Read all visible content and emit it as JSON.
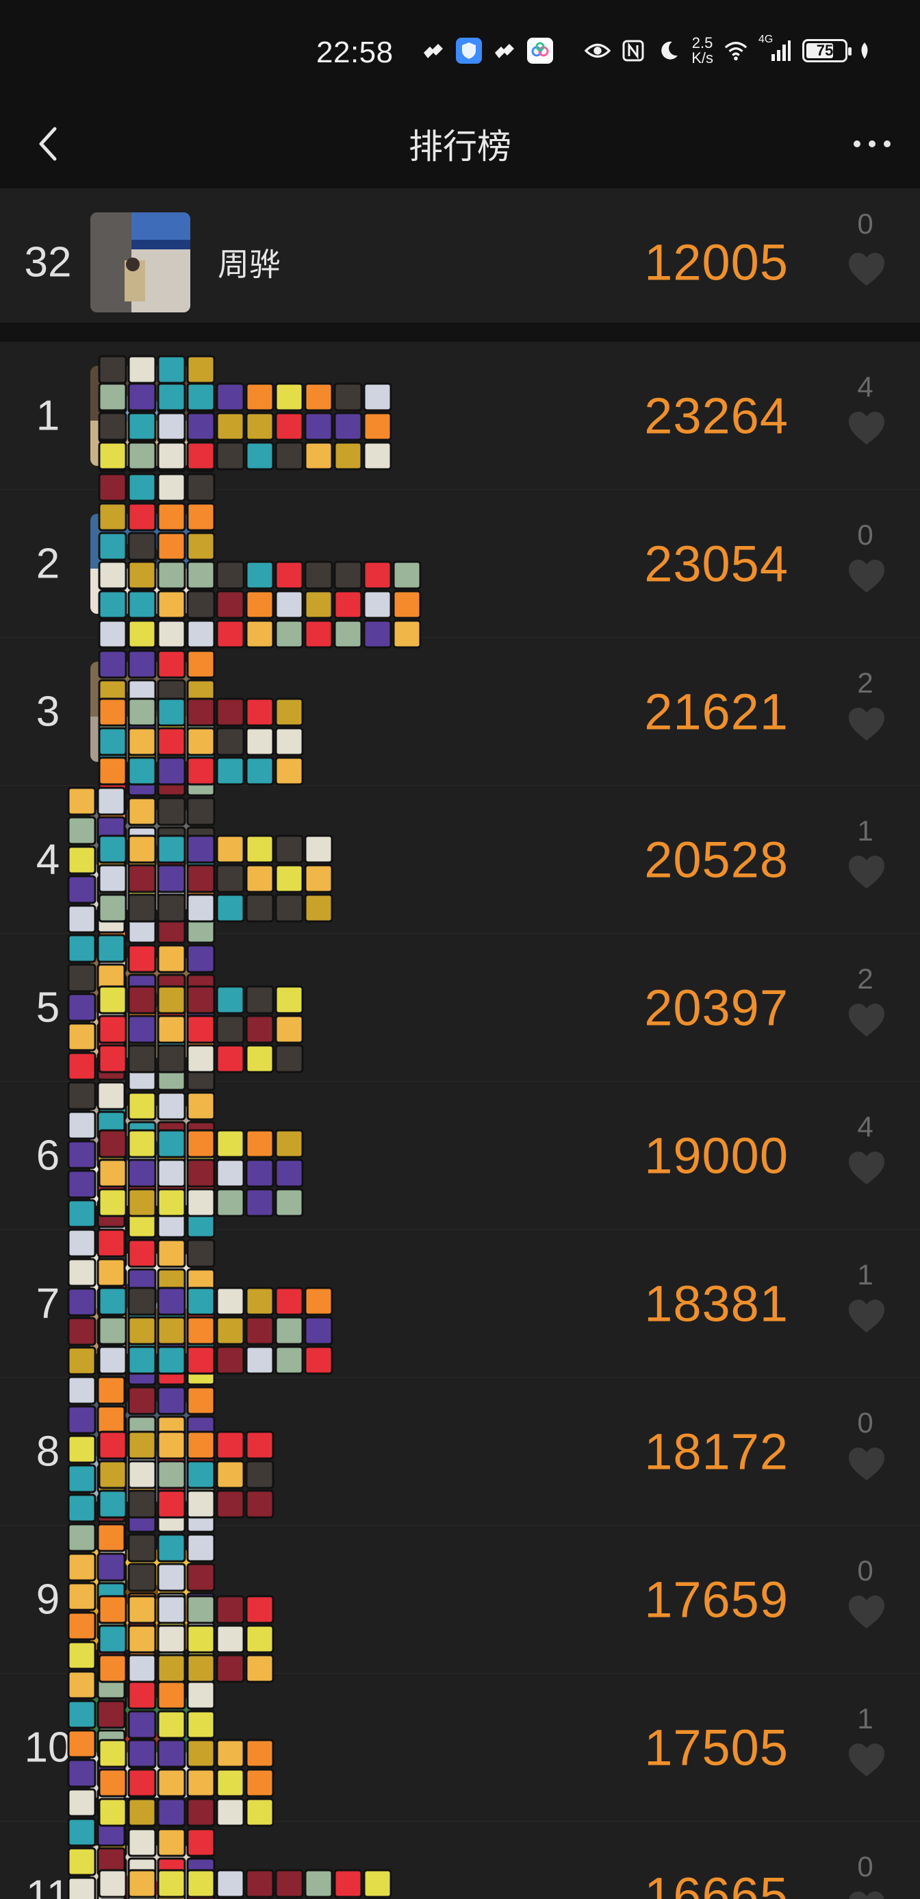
{
  "status_bar": {
    "time": "22:58",
    "network_speed_value": "2.5",
    "network_speed_unit": "K/s",
    "signal_label": "4G",
    "battery_level": "75",
    "icons": [
      "tiktok-icon",
      "shield-icon",
      "tiktok-icon",
      "cloud-app-icon",
      "eye-icon",
      "nfc-icon",
      "moon-icon",
      "wifi-icon",
      "signal-icon",
      "battery-icon",
      "leaf-icon"
    ]
  },
  "header": {
    "title": "排行榜",
    "back_icon": "chevron-left-icon",
    "more_icon": "more-dots-icon"
  },
  "my_rank": {
    "rank": "32",
    "name": "周骅",
    "steps": "12005",
    "likes": "0"
  },
  "colors": {
    "steps": "#f0902c",
    "likes": "#6a6a6a",
    "background": "#181818",
    "row": "#1f1f1f"
  },
  "rankings": [
    {
      "rank": "1",
      "name": "",
      "steps": "23264",
      "likes": "4"
    },
    {
      "rank": "2",
      "name": "",
      "steps": "23054",
      "likes": "0"
    },
    {
      "rank": "3",
      "name": "",
      "steps": "21621",
      "likes": "2"
    },
    {
      "rank": "4",
      "name": "",
      "steps": "20528",
      "likes": "1"
    },
    {
      "rank": "5",
      "name": "",
      "steps": "20397",
      "likes": "2"
    },
    {
      "rank": "6",
      "name": "",
      "steps": "19000",
      "likes": "4"
    },
    {
      "rank": "7",
      "name": "",
      "steps": "18381",
      "likes": "1"
    },
    {
      "rank": "8",
      "name": "",
      "steps": "18172",
      "likes": "0"
    },
    {
      "rank": "9",
      "name": "",
      "steps": "17659",
      "likes": "0"
    },
    {
      "rank": "10",
      "name": "",
      "steps": "17505",
      "likes": "1"
    },
    {
      "rank": "11",
      "name": "",
      "steps": "16665",
      "likes": "0"
    }
  ]
}
